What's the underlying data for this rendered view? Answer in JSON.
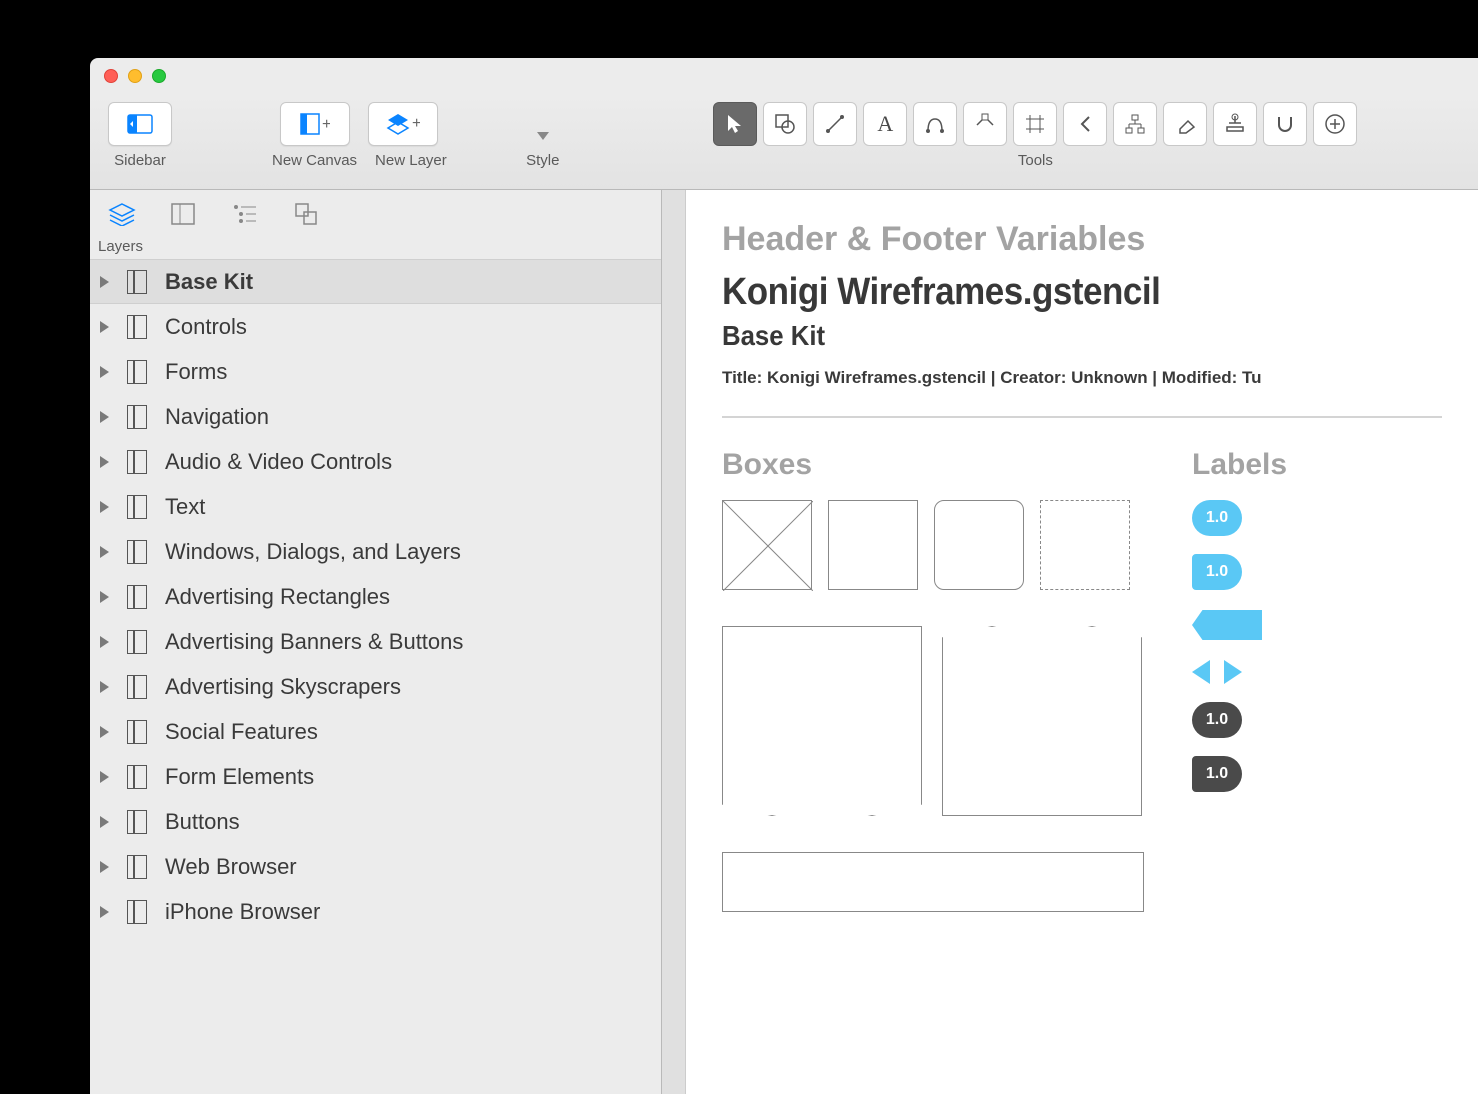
{
  "toolbar": {
    "sidebar_label": "Sidebar",
    "new_canvas_label": "New Canvas",
    "new_layer_label": "New Layer",
    "style_label": "Style",
    "tools_label": "Tools"
  },
  "sidebar": {
    "section_label": "Layers",
    "items": [
      {
        "label": "Base Kit",
        "selected": true
      },
      {
        "label": "Controls"
      },
      {
        "label": "Forms"
      },
      {
        "label": "Navigation"
      },
      {
        "label": "Audio & Video Controls"
      },
      {
        "label": "Text"
      },
      {
        "label": "Windows, Dialogs, and Layers"
      },
      {
        "label": "Advertising Rectangles"
      },
      {
        "label": "Advertising Banners & Buttons"
      },
      {
        "label": "Advertising Skyscrapers"
      },
      {
        "label": "Social Features"
      },
      {
        "label": "Form Elements"
      },
      {
        "label": "Buttons"
      },
      {
        "label": "Web Browser"
      },
      {
        "label": "iPhone Browser"
      }
    ]
  },
  "canvas": {
    "header_label": "Header & Footer Variables",
    "title": "Konigi Wireframes.gstencil",
    "subtitle": "Base Kit",
    "meta": "Title: Konigi Wireframes.gstencil  |  Creator: Unknown  |  Modified: Tu",
    "boxes_heading": "Boxes",
    "labels_heading": "Labels",
    "label_values": [
      "1.0",
      "1.0",
      "1.0",
      "1.0"
    ]
  }
}
